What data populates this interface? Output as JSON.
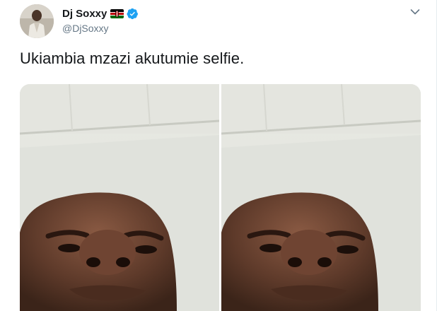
{
  "tweet": {
    "display_name": "Dj Soxxy",
    "handle": "@DjSoxxy",
    "text": "Ukiambia mzazi akutumie selfie.",
    "verified": true
  },
  "icons": {
    "avatar": "profile-avatar",
    "flag": "kenya-flag-icon",
    "verified": "verified-badge-icon",
    "menu": "chevron-down-icon"
  },
  "media": {
    "photo_count": 2
  },
  "colors": {
    "name": "#14171a",
    "handle": "#657786",
    "verified": "#1da1f2",
    "chevron": "#657786"
  }
}
